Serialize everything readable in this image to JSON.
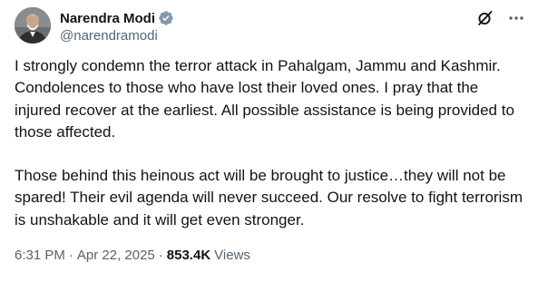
{
  "author": {
    "display_name": "Narendra Modi",
    "handle": "@narendramodi",
    "verified_color": "#829aab"
  },
  "actions": {
    "grok_icon": "grok-icon",
    "more_icon": "more-icon"
  },
  "tweet": {
    "paragraph_1": "I strongly condemn the terror attack in Pahalgam, Jammu and Kashmir. Condolences to those who have lost their loved ones. I pray that the injured recover at the earliest. All possible assistance is being provided to those affected.",
    "paragraph_2": "Those behind this heinous act will be brought to justice…they will not be spared! Their evil agenda will never succeed. Our resolve to fight terrorism is unshakable and it will get even stronger."
  },
  "meta": {
    "time": "6:31 PM",
    "separator": "·",
    "date": "Apr 22, 2025",
    "views_count": "853.4K",
    "views_label": "Views"
  },
  "colors": {
    "text_primary": "#0f1419",
    "text_secondary": "#536471",
    "background": "#ffffff"
  }
}
